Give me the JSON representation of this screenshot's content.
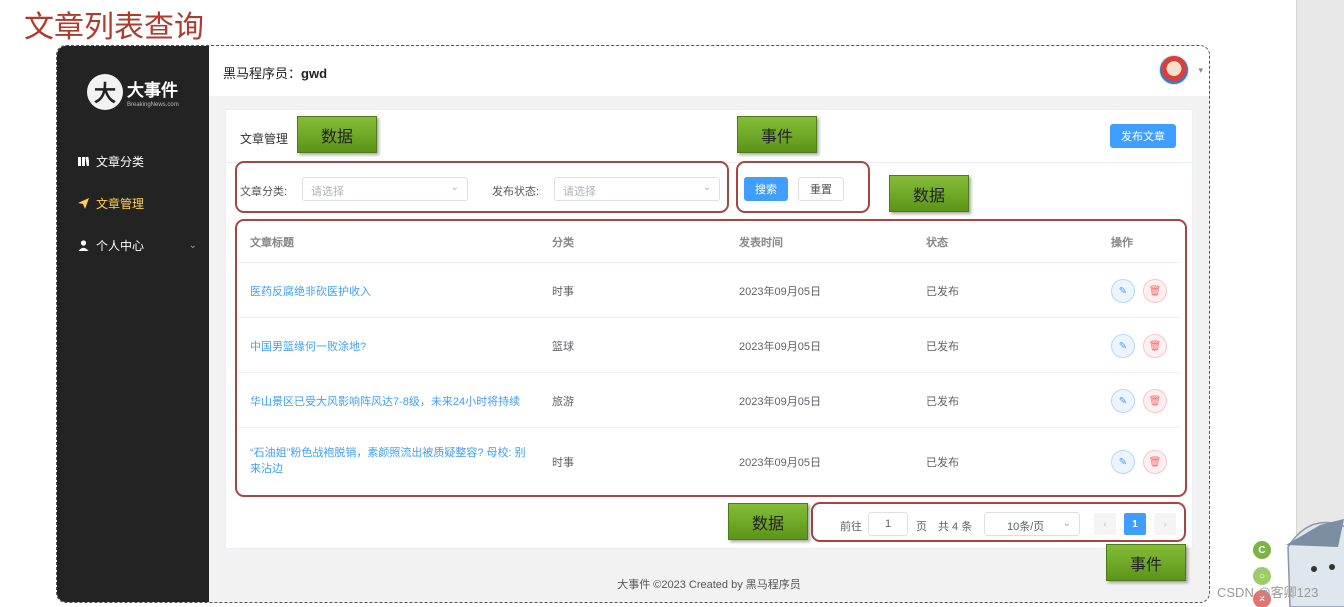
{
  "heading": "文章列表查询",
  "sidebar": {
    "logo_mark": "大",
    "logo_title": "大事件",
    "logo_sub": "BreakingNews.com",
    "items": [
      {
        "label": "文章分类",
        "icon": "book-icon"
      },
      {
        "label": "文章管理",
        "icon": "paper-plane-icon",
        "active": true
      },
      {
        "label": "个人中心",
        "icon": "user-icon",
        "has_submenu": true
      }
    ],
    "active_color": "#ffd04b"
  },
  "topbar": {
    "user_prefix": "黑马程序员：",
    "username": "gwd"
  },
  "card": {
    "title": "文章管理",
    "publish_label": "发布文章"
  },
  "filters": {
    "category_label": "文章分类:",
    "category_placeholder": "请选择",
    "status_label": "发布状态:",
    "status_placeholder": "请选择",
    "search_label": "搜索",
    "reset_label": "重置"
  },
  "table": {
    "columns": [
      "文章标题",
      "分类",
      "发表时间",
      "状态",
      "操作"
    ],
    "rows": [
      {
        "title": "医药反腐绝非砍医护收入",
        "category": "时事",
        "date": "2023年09月05日",
        "status": "已发布"
      },
      {
        "title": "中国男篮缘何一败涂地?",
        "category": "篮球",
        "date": "2023年09月05日",
        "status": "已发布"
      },
      {
        "title": "华山景区已受大风影响阵风达7-8级，未来24小时将持续",
        "category": "旅游",
        "date": "2023年09月05日",
        "status": "已发布"
      },
      {
        "title": "“石油姐”粉色战袍脱销，素颜照流出被质疑整容? 母校: 别来沾边",
        "category": "时事",
        "date": "2023年09月05日",
        "status": "已发布"
      }
    ]
  },
  "pagination": {
    "goto_label": "前往",
    "goto_value": "1",
    "page_unit": "页",
    "total_label": "共 4 条",
    "page_size": "10条/页",
    "current_page": "1",
    "prev": "‹",
    "next": "›"
  },
  "footer": "大事件 ©2023 Created by 黑马程序员",
  "annotations": {
    "data": "数据",
    "event": "事件"
  },
  "watermark": "CSDN @客卿123",
  "colors": {
    "primary": "#409eff",
    "danger": "#f56c6c",
    "annotation_red": "#a94442",
    "annotation_green": "#6aa321",
    "heading_red": "#b03a2e"
  }
}
